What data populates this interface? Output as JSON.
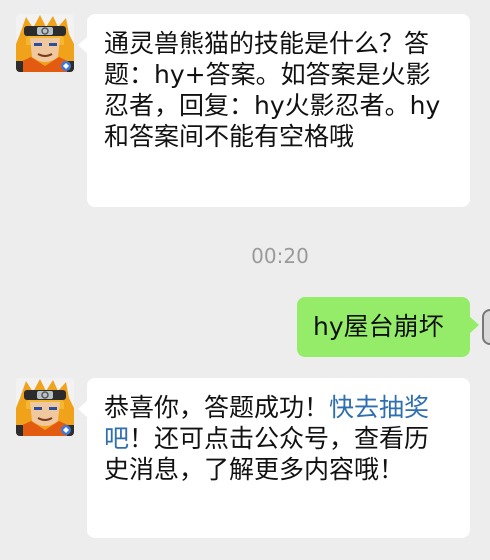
{
  "conversation": {
    "messages": [
      {
        "side": "left",
        "text": "通灵兽熊猫的技能是什么？答题：hy+答案。如答案是火影忍者，回复：hy火影忍者。hy和答案间不能有空格哦"
      },
      {
        "side": "right",
        "text": "hy屋台崩坏"
      },
      {
        "side": "left",
        "text_before_link": "恭喜你，答题成功！",
        "link_text": "快去抽奖吧",
        "text_after_link": "！还可点击公众号，查看历史消息，了解更多内容哦！"
      }
    ],
    "timestamp": "00:20"
  },
  "colors": {
    "background": "#ededed",
    "incoming_bubble": "#ffffff",
    "outgoing_bubble": "#95ec69",
    "link": "#2f6fb0",
    "timestamp": "#9a9a9a"
  },
  "icons": {
    "sender_avatar": "ninja-avatar-icon"
  }
}
